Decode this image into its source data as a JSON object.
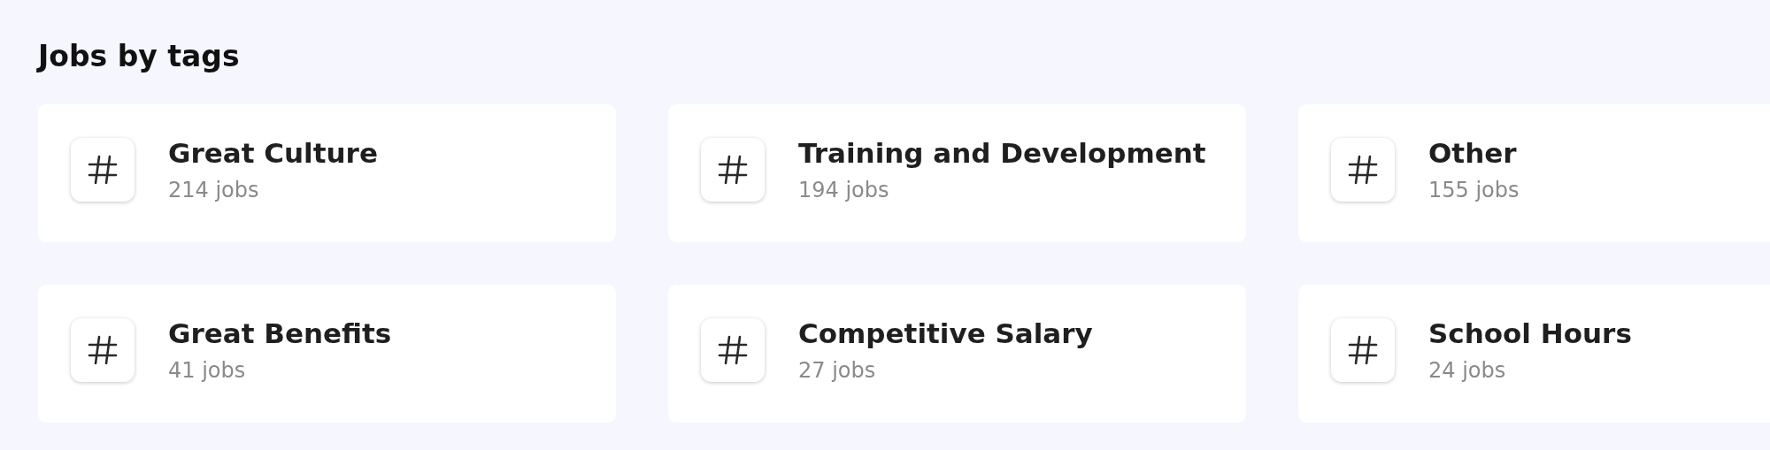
{
  "heading": "Jobs by tags",
  "tags": [
    {
      "name": "Great Culture",
      "count": "214 jobs"
    },
    {
      "name": "Training and Development",
      "count": "194 jobs"
    },
    {
      "name": "Other",
      "count": "155 jobs"
    },
    {
      "name": "Great Benefits",
      "count": "41 jobs"
    },
    {
      "name": "Competitive Salary",
      "count": "27 jobs"
    },
    {
      "name": "School Hours",
      "count": "24 jobs"
    }
  ]
}
